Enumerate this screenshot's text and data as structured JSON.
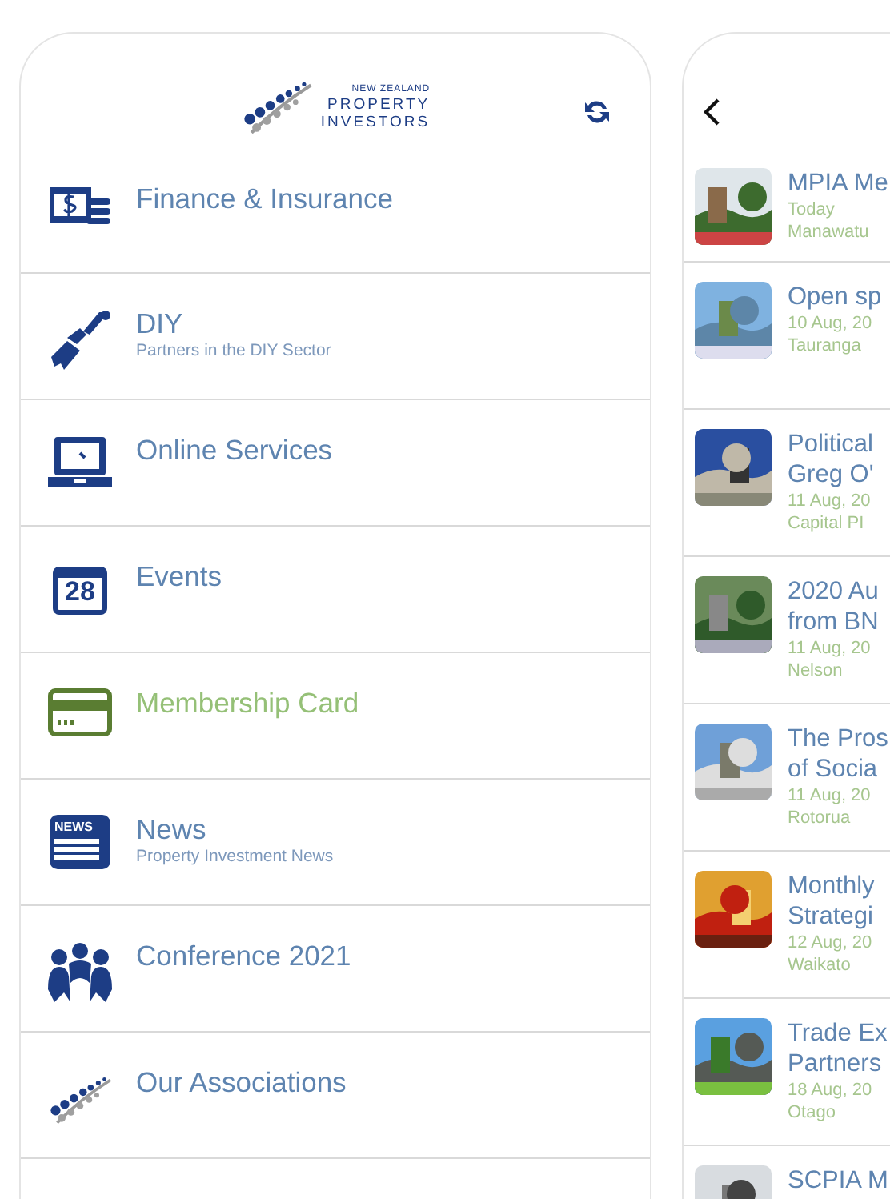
{
  "header": {
    "logo_lines": [
      "NEW ZEALAND",
      "PROPERTY",
      "INVESTORS"
    ]
  },
  "menu": [
    {
      "kind": "finance",
      "title": "Finance & Insurance",
      "selected": false
    },
    {
      "kind": "diy",
      "title": "DIY",
      "subtitle": "Partners in the DIY Sector",
      "selected": false
    },
    {
      "kind": "online",
      "title": "Online Services",
      "selected": false
    },
    {
      "kind": "events",
      "title": "Events",
      "icon_text": "28",
      "selected": false
    },
    {
      "kind": "card",
      "title": "Membership Card",
      "selected": true
    },
    {
      "kind": "news",
      "title": "News",
      "subtitle": "Property Investment News",
      "icon_text": "NEWS",
      "selected": false
    },
    {
      "kind": "people",
      "title": "Conference 2021",
      "selected": false
    },
    {
      "kind": "logo",
      "title": "Our Associations",
      "selected": false
    }
  ],
  "events": [
    {
      "title_lines": [
        "MPIA Me"
      ],
      "date": "Today",
      "location": "Manawatu"
    },
    {
      "title_lines": [
        "Open sp"
      ],
      "date": "10 Aug, 20",
      "location": "Tauranga"
    },
    {
      "title_lines": [
        "Political",
        "Greg O'"
      ],
      "date": "11 Aug, 20",
      "location": "Capital PI"
    },
    {
      "title_lines": [
        "2020 Au",
        "from BN"
      ],
      "date": "11 Aug, 20",
      "location": "Nelson"
    },
    {
      "title_lines": [
        "The Pros",
        "of Socia"
      ],
      "date": "11 Aug, 20",
      "location": "Rotorua"
    },
    {
      "title_lines": [
        "Monthly",
        "Strategi"
      ],
      "date": "12 Aug, 20",
      "location": "Waikato"
    },
    {
      "title_lines": [
        "Trade Ex",
        "Partners"
      ],
      "date": "18 Aug, 20",
      "location": "Otago"
    },
    {
      "title_lines": [
        "SCPIA M"
      ]
    }
  ]
}
